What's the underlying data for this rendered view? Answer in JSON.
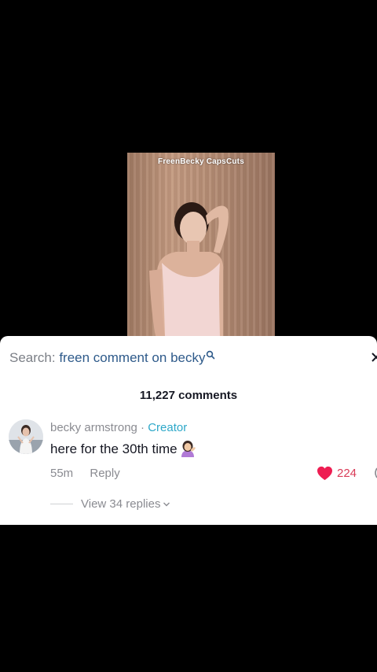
{
  "video": {
    "watermark": "FreenBecky CapsCuts"
  },
  "comments_sheet": {
    "search_prefix": "Search:",
    "search_term": "freen comment on becky",
    "comment_count": "11,227 comments",
    "comment": {
      "author": "becky armstrong",
      "separator": "·",
      "badge": "Creator",
      "text": "here for the 30th time",
      "emoji_icon": "woman-tipping-hand-emoji",
      "age": "55m",
      "reply_label": "Reply",
      "likes": "224",
      "like_color": "#ee1d52"
    },
    "view_replies": "View 34 replies"
  },
  "colors": {
    "accent_search": "#2e5a8a",
    "creator_badge": "#2da8c9"
  }
}
